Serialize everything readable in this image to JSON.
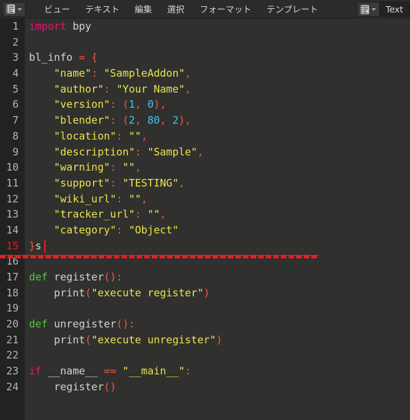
{
  "header": {
    "editor_type_icon": "text-editor-icon",
    "editor_type_chevron": "chevron-down-icon",
    "menus": [
      {
        "label": "ビュー"
      },
      {
        "label": "テキスト"
      },
      {
        "label": "編集"
      },
      {
        "label": "選択"
      },
      {
        "label": "フォーマット"
      },
      {
        "label": "テンプレート"
      }
    ],
    "datablock": {
      "icon": "text-datablock-icon",
      "chevron": "chevron-down-icon",
      "name": "Text"
    }
  },
  "editor": {
    "background_color": "#30302f",
    "gutter_color": "#222221",
    "error_color": "#ef1b1b",
    "cursor_color": "#e02020",
    "error_line": 15,
    "lines": [
      {
        "n": "1",
        "tokens": [
          {
            "t": "kw",
            "v": "import"
          },
          {
            "t": "plain",
            "v": " bpy"
          }
        ]
      },
      {
        "n": "2",
        "tokens": []
      },
      {
        "n": "3",
        "tokens": [
          {
            "t": "plain",
            "v": "bl_info "
          },
          {
            "t": "punc",
            "v": "="
          },
          {
            "t": "plain",
            "v": " "
          },
          {
            "t": "punc",
            "v": "{"
          }
        ]
      },
      {
        "n": "4",
        "tokens": [
          {
            "t": "plain",
            "v": "    "
          },
          {
            "t": "str",
            "v": "\"name\""
          },
          {
            "t": "punc",
            "v": ":"
          },
          {
            "t": "plain",
            "v": " "
          },
          {
            "t": "str",
            "v": "\"SampleAddon\""
          },
          {
            "t": "punc",
            "v": ","
          }
        ]
      },
      {
        "n": "5",
        "tokens": [
          {
            "t": "plain",
            "v": "    "
          },
          {
            "t": "str",
            "v": "\"author\""
          },
          {
            "t": "punc",
            "v": ":"
          },
          {
            "t": "plain",
            "v": " "
          },
          {
            "t": "str",
            "v": "\"Your Name\""
          },
          {
            "t": "punc",
            "v": ","
          }
        ]
      },
      {
        "n": "6",
        "tokens": [
          {
            "t": "plain",
            "v": "    "
          },
          {
            "t": "str",
            "v": "\"version\""
          },
          {
            "t": "punc",
            "v": ":"
          },
          {
            "t": "plain",
            "v": " "
          },
          {
            "t": "punc",
            "v": "("
          },
          {
            "t": "num",
            "v": "1"
          },
          {
            "t": "punc",
            "v": ","
          },
          {
            "t": "plain",
            "v": " "
          },
          {
            "t": "num",
            "v": "0"
          },
          {
            "t": "punc",
            "v": "),"
          }
        ]
      },
      {
        "n": "7",
        "tokens": [
          {
            "t": "plain",
            "v": "    "
          },
          {
            "t": "str",
            "v": "\"blender\""
          },
          {
            "t": "punc",
            "v": ":"
          },
          {
            "t": "plain",
            "v": " "
          },
          {
            "t": "punc",
            "v": "("
          },
          {
            "t": "num",
            "v": "2"
          },
          {
            "t": "punc",
            "v": ","
          },
          {
            "t": "plain",
            "v": " "
          },
          {
            "t": "num",
            "v": "80"
          },
          {
            "t": "punc",
            "v": ","
          },
          {
            "t": "plain",
            "v": " "
          },
          {
            "t": "num",
            "v": "2"
          },
          {
            "t": "punc",
            "v": "),"
          }
        ]
      },
      {
        "n": "8",
        "tokens": [
          {
            "t": "plain",
            "v": "    "
          },
          {
            "t": "str",
            "v": "\"location\""
          },
          {
            "t": "punc",
            "v": ":"
          },
          {
            "t": "plain",
            "v": " "
          },
          {
            "t": "str",
            "v": "\"\""
          },
          {
            "t": "punc",
            "v": ","
          }
        ]
      },
      {
        "n": "9",
        "tokens": [
          {
            "t": "plain",
            "v": "    "
          },
          {
            "t": "str",
            "v": "\"description\""
          },
          {
            "t": "punc",
            "v": ":"
          },
          {
            "t": "plain",
            "v": " "
          },
          {
            "t": "str",
            "v": "\"Sample\""
          },
          {
            "t": "punc",
            "v": ","
          }
        ]
      },
      {
        "n": "10",
        "tokens": [
          {
            "t": "plain",
            "v": "    "
          },
          {
            "t": "str",
            "v": "\"warning\""
          },
          {
            "t": "punc",
            "v": ":"
          },
          {
            "t": "plain",
            "v": " "
          },
          {
            "t": "str",
            "v": "\"\""
          },
          {
            "t": "punc",
            "v": ","
          }
        ]
      },
      {
        "n": "11",
        "tokens": [
          {
            "t": "plain",
            "v": "    "
          },
          {
            "t": "str",
            "v": "\"support\""
          },
          {
            "t": "punc",
            "v": ":"
          },
          {
            "t": "plain",
            "v": " "
          },
          {
            "t": "str",
            "v": "\"TESTING\""
          },
          {
            "t": "punc",
            "v": ","
          }
        ]
      },
      {
        "n": "12",
        "tokens": [
          {
            "t": "plain",
            "v": "    "
          },
          {
            "t": "str",
            "v": "\"wiki_url\""
          },
          {
            "t": "punc",
            "v": ":"
          },
          {
            "t": "plain",
            "v": " "
          },
          {
            "t": "str",
            "v": "\"\""
          },
          {
            "t": "punc",
            "v": ","
          }
        ]
      },
      {
        "n": "13",
        "tokens": [
          {
            "t": "plain",
            "v": "    "
          },
          {
            "t": "str",
            "v": "\"tracker_url\""
          },
          {
            "t": "punc",
            "v": ":"
          },
          {
            "t": "plain",
            "v": " "
          },
          {
            "t": "str",
            "v": "\"\""
          },
          {
            "t": "punc",
            "v": ","
          }
        ]
      },
      {
        "n": "14",
        "tokens": [
          {
            "t": "plain",
            "v": "    "
          },
          {
            "t": "str",
            "v": "\"category\""
          },
          {
            "t": "punc",
            "v": ":"
          },
          {
            "t": "plain",
            "v": " "
          },
          {
            "t": "str",
            "v": "\"Object\""
          }
        ]
      },
      {
        "n": "15",
        "tokens": [
          {
            "t": "punc",
            "v": "}"
          },
          {
            "t": "plain",
            "v": "s"
          }
        ],
        "error": true
      },
      {
        "n": "16",
        "tokens": []
      },
      {
        "n": "17",
        "tokens": [
          {
            "t": "def",
            "v": "def"
          },
          {
            "t": "plain",
            "v": " register"
          },
          {
            "t": "punc",
            "v": "():"
          }
        ]
      },
      {
        "n": "18",
        "tokens": [
          {
            "t": "plain",
            "v": "    print"
          },
          {
            "t": "punc",
            "v": "("
          },
          {
            "t": "str",
            "v": "\"execute register\""
          },
          {
            "t": "punc",
            "v": ")"
          }
        ]
      },
      {
        "n": "19",
        "tokens": []
      },
      {
        "n": "20",
        "tokens": [
          {
            "t": "def",
            "v": "def"
          },
          {
            "t": "plain",
            "v": " unregister"
          },
          {
            "t": "punc",
            "v": "():"
          }
        ]
      },
      {
        "n": "21",
        "tokens": [
          {
            "t": "plain",
            "v": "    print"
          },
          {
            "t": "punc",
            "v": "("
          },
          {
            "t": "str",
            "v": "\"execute unregister\""
          },
          {
            "t": "punc",
            "v": ")"
          }
        ]
      },
      {
        "n": "22",
        "tokens": []
      },
      {
        "n": "23",
        "tokens": [
          {
            "t": "kw",
            "v": "if"
          },
          {
            "t": "plain",
            "v": " __name__ "
          },
          {
            "t": "punc",
            "v": "=="
          },
          {
            "t": "plain",
            "v": " "
          },
          {
            "t": "str",
            "v": "\"__main__\""
          },
          {
            "t": "punc",
            "v": ":"
          }
        ]
      },
      {
        "n": "24",
        "tokens": [
          {
            "t": "plain",
            "v": "    register"
          },
          {
            "t": "punc",
            "v": "()"
          }
        ]
      }
    ]
  }
}
